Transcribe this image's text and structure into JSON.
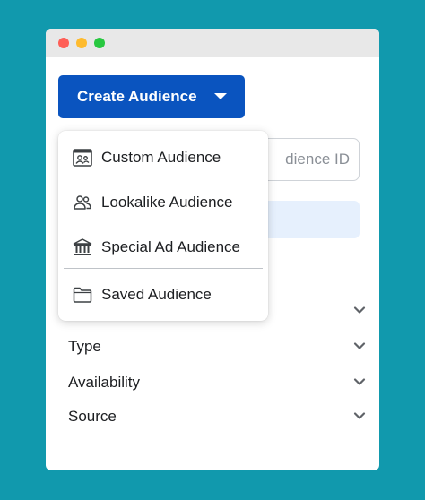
{
  "window": {
    "controls": [
      "close",
      "minimize",
      "maximize"
    ]
  },
  "create_button": {
    "label": "Create Audience",
    "icon": "caret-down-icon"
  },
  "search": {
    "placeholder": "Search by name or audience ID",
    "visible_text": "dience ID"
  },
  "dropdown": {
    "items": [
      {
        "label": "Custom Audience",
        "icon": "custom-audience-icon"
      },
      {
        "label": "Lookalike Audience",
        "icon": "people-icon"
      },
      {
        "label": "Special Ad Audience",
        "icon": "bank-icon"
      },
      {
        "label": "Saved Audience",
        "icon": "folder-icon"
      }
    ]
  },
  "filters": [
    {
      "label": "",
      "icon": "chevron-down-icon"
    },
    {
      "label": "Type",
      "icon": "chevron-down-icon"
    },
    {
      "label": "Availability",
      "icon": "chevron-down-icon"
    },
    {
      "label": "Source",
      "icon": "chevron-down-icon"
    }
  ],
  "colors": {
    "background": "#1199ad",
    "primary_button": "#0a54bf",
    "highlight": "#e6f0fd"
  }
}
